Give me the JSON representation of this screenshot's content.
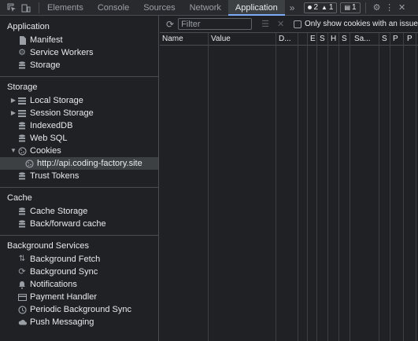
{
  "toolbar": {
    "tabs": [
      "Elements",
      "Console",
      "Sources",
      "Network",
      "Application"
    ],
    "active_tab": "Application",
    "more": "»",
    "errors_count": "2",
    "warnings_count": "1",
    "messages_count": "1",
    "error_color": "#e8eaed",
    "warning_color": "#fdd663",
    "accent_color": "#7cacf8"
  },
  "sidebar": {
    "application": {
      "title": "Application",
      "items": [
        {
          "label": "Manifest",
          "icon": "document-icon"
        },
        {
          "label": "Service Workers",
          "icon": "gear-icon"
        },
        {
          "label": "Storage",
          "icon": "database-icon"
        }
      ]
    },
    "storage": {
      "title": "Storage",
      "items": [
        {
          "label": "Local Storage",
          "icon": "grid-icon"
        },
        {
          "label": "Session Storage",
          "icon": "grid-icon"
        },
        {
          "label": "IndexedDB",
          "icon": "database-icon"
        },
        {
          "label": "Web SQL",
          "icon": "database-icon"
        },
        {
          "label": "Cookies",
          "icon": "cookie-icon"
        },
        {
          "label": "http://api.coding-factory.site",
          "icon": "cookie-icon"
        },
        {
          "label": "Trust Tokens",
          "icon": "database-icon"
        }
      ]
    },
    "cache": {
      "title": "Cache",
      "items": [
        {
          "label": "Cache Storage",
          "icon": "database-icon"
        },
        {
          "label": "Back/forward cache",
          "icon": "database-icon"
        }
      ]
    },
    "background": {
      "title": "Background Services",
      "items": [
        {
          "label": "Background Fetch",
          "icon": "fetch-icon"
        },
        {
          "label": "Background Sync",
          "icon": "sync-icon"
        },
        {
          "label": "Notifications",
          "icon": "bell-icon"
        },
        {
          "label": "Payment Handler",
          "icon": "card-icon"
        },
        {
          "label": "Periodic Background Sync",
          "icon": "clock-icon"
        },
        {
          "label": "Push Messaging",
          "icon": "cloud-icon"
        }
      ]
    }
  },
  "cookies_panel": {
    "filter_placeholder": "Filter",
    "only_issues_label": "Only show cookies with an issue",
    "columns": [
      "Name",
      "Value",
      "D...",
      "E",
      "S",
      "H",
      "S",
      "Sa...",
      "S",
      "P",
      "P"
    ]
  }
}
